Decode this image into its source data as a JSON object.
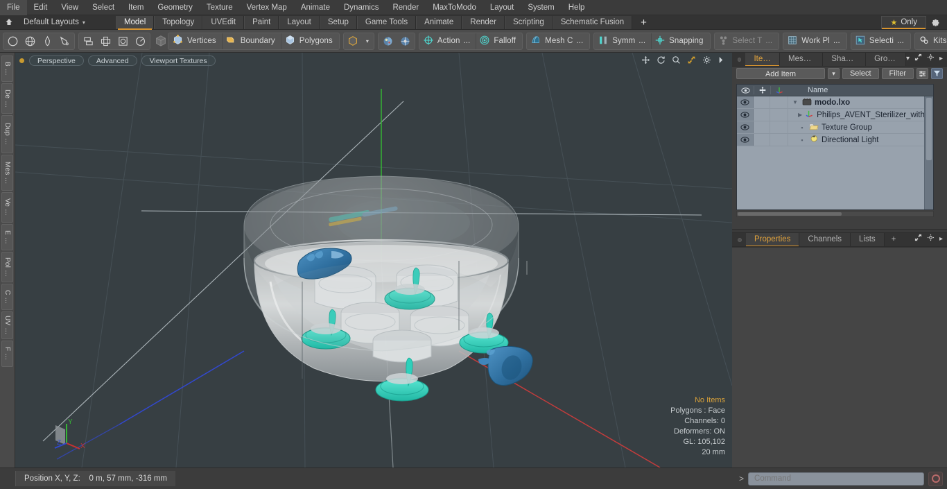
{
  "app": {
    "title": "modo",
    "document": "modo.lxo"
  },
  "menubar": {
    "items": [
      {
        "label": "File"
      },
      {
        "label": "Edit"
      },
      {
        "label": "View"
      },
      {
        "label": "Select"
      },
      {
        "label": "Item"
      },
      {
        "label": "Geometry"
      },
      {
        "label": "Texture"
      },
      {
        "label": "Vertex Map"
      },
      {
        "label": "Animate"
      },
      {
        "label": "Dynamics"
      },
      {
        "label": "Render"
      },
      {
        "label": "MaxToModo"
      },
      {
        "label": "Layout"
      },
      {
        "label": "System"
      },
      {
        "label": "Help"
      }
    ]
  },
  "layoutbar": {
    "home_icon": "home-icon",
    "preset": "Default Layouts",
    "caret": "▾",
    "tabs": [
      {
        "label": "Model",
        "active": true
      },
      {
        "label": "Topology",
        "active": false
      },
      {
        "label": "UVEdit",
        "active": false
      },
      {
        "label": "Paint",
        "active": false
      },
      {
        "label": "Layout",
        "active": false
      },
      {
        "label": "Setup",
        "active": false
      },
      {
        "label": "Game Tools",
        "active": false
      },
      {
        "label": "Animate",
        "active": false
      },
      {
        "label": "Render",
        "active": false
      },
      {
        "label": "Scripting",
        "active": false
      },
      {
        "label": "Schematic Fusion",
        "active": false
      }
    ],
    "add_tab": "+",
    "only_button": {
      "label": "Only",
      "star": "★"
    },
    "settings_icon": "gear-icon"
  },
  "toolbar": {
    "shape_icons": [
      "circle-icon",
      "globe-icon",
      "pen-icon",
      "brush-icon"
    ],
    "arrange_icons": [
      "align-icon",
      "center-icon",
      "frame-icon",
      "radial-icon"
    ],
    "cube_icon": "cube-icon",
    "selection_modes": [
      {
        "label": "Vertices",
        "icon": "vertices-icon"
      },
      {
        "label": "Boundary",
        "icon": "boundary-icon"
      },
      {
        "label": "Polygons",
        "icon": "polygons-icon"
      }
    ],
    "mode_cube": "cube-mode-icon",
    "mode_caret": "▾",
    "paint_icons": [
      "paint-sphere-icon",
      "paint-sphere-alt-icon"
    ],
    "tools": [
      {
        "label": "Action",
        "suffix": "...",
        "icon": "action-center-icon",
        "dim": false
      },
      {
        "label": "Falloff",
        "suffix": "",
        "icon": "falloff-icon",
        "dim": false
      },
      {
        "label": "Mesh C",
        "suffix": "...",
        "icon": "mesh-constraint-icon",
        "dim": false
      },
      {
        "label": "Symm",
        "suffix": "...",
        "icon": "symmetry-icon",
        "dim": false
      },
      {
        "label": "Snapping",
        "suffix": "",
        "icon": "snapping-icon",
        "dim": false
      },
      {
        "label": "Select T",
        "suffix": "...",
        "icon": "select-through-icon",
        "dim": true
      },
      {
        "label": "Work Pl",
        "suffix": "...",
        "icon": "work-plane-icon",
        "dim": false
      },
      {
        "label": "Selecti",
        "suffix": "...",
        "icon": "selection-set-icon",
        "dim": false
      },
      {
        "label": "Kits",
        "suffix": "",
        "icon": "kits-icon",
        "dim": false
      }
    ],
    "round_buttons": [
      "modo-logo-icon",
      "unreal-logo-icon"
    ]
  },
  "leftbar": {
    "tabs": [
      {
        "label": "B …"
      },
      {
        "label": "De …"
      },
      {
        "label": "Dup …"
      },
      {
        "label": "Mes …"
      },
      {
        "label": "Ve …"
      },
      {
        "label": "E …"
      },
      {
        "label": "Pol …"
      },
      {
        "label": "C …"
      },
      {
        "label": "UV …"
      },
      {
        "label": "F …"
      }
    ]
  },
  "viewport": {
    "indicator": "active-dot",
    "pills": [
      "Perspective",
      "Advanced",
      "Viewport Textures"
    ],
    "icons": [
      "move-icon",
      "rotate-icon",
      "zoom-icon",
      "maximize-icon",
      "gear-icon",
      "chevron-right-icon"
    ],
    "stats": {
      "items_label": "No Items",
      "polygons": "Polygons : Face",
      "channels": "Channels: 0",
      "deformers": "Deformers: ON",
      "gl": "GL: 105,102",
      "scale": "20 mm"
    },
    "gizmo": {
      "x": "X",
      "y": "Y",
      "z": "Z",
      "x_color": "#c83232",
      "y_color": "#36b636",
      "z_color": "#3048d0"
    },
    "model_description": "Philips AVENT electric steam sterilizer, transparent lid, white base with baby bottles and teal teats",
    "background_color": "#373f43"
  },
  "rightpanel": {
    "tabs": [
      {
        "label": "Items",
        "active": true
      },
      {
        "label": "Mesh …",
        "active": false
      },
      {
        "label": "Shading",
        "active": false
      },
      {
        "label": "Groups",
        "active": false
      }
    ],
    "tab_icons": [
      "chevron-down-icon",
      "expand-icon",
      "gear-icon",
      "chevron-right-icon"
    ],
    "actions": {
      "add_item": "Add Item",
      "add_item_caret": "▾",
      "select": "Select",
      "filter": "Filter",
      "list_icon": "list-options-icon",
      "funnel_icon": "funnel-icon"
    },
    "list": {
      "columns": [
        {
          "label": "",
          "icon": "eye-icon"
        },
        {
          "label": "",
          "icon": "lock-move-icon"
        },
        {
          "label": "",
          "icon": "axis-icon"
        },
        {
          "label": "Name"
        }
      ],
      "rows": [
        {
          "name": "modo.lxo",
          "icon": "scene-icon",
          "depth": 0,
          "twisty": "▼",
          "root": true
        },
        {
          "name": "Philips_AVENT_Sterilizer_with …",
          "icon": "mesh-axis-icon",
          "depth": 1,
          "twisty": "▶",
          "root": false
        },
        {
          "name": "Texture Group",
          "icon": "folder-icon",
          "depth": 1,
          "twisty": "",
          "root": false
        },
        {
          "name": "Directional Light",
          "icon": "light-icon",
          "depth": 1,
          "twisty": "",
          "root": false
        }
      ]
    }
  },
  "properties": {
    "tabs": [
      {
        "label": "Properties",
        "active": true
      },
      {
        "label": "Channels",
        "active": false
      },
      {
        "label": "Lists",
        "active": false
      }
    ],
    "add_tab": "+",
    "icons": [
      "expand-icon",
      "gear-icon",
      "chevron-right-icon"
    ]
  },
  "statusbar": {
    "position_label": "Position X, Y, Z:",
    "position_value": "0 m, 57 mm, -316 mm",
    "command_prompt": ">",
    "command_placeholder": "Command",
    "record_icon": "record-icon"
  },
  "colors": {
    "accent": "#d9952f",
    "panel": "#4c4c4c",
    "viewport": "#373f43",
    "list_bg": "#98a2ad",
    "teal": "#3fd9c4",
    "blue_part": "#2d6f9e"
  }
}
